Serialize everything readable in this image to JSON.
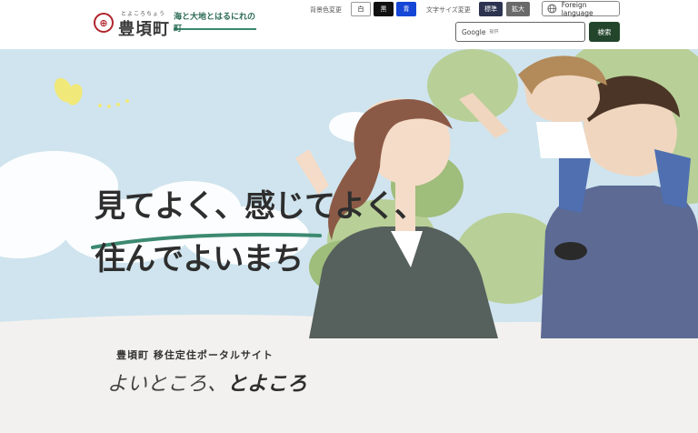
{
  "header": {
    "logo": {
      "seal_icon": "town-seal-icon",
      "ruby": "とよころちょう",
      "town_name": "豊頃町",
      "tagline": "海と大地とはるにれの町"
    },
    "background_color": {
      "label": "背景色変更",
      "options": [
        {
          "label": "白",
          "color": "#ffffff"
        },
        {
          "label": "黒",
          "color": "#111111"
        },
        {
          "label": "青",
          "color": "#1546d6"
        }
      ]
    },
    "font_size": {
      "label": "文字サイズ変更",
      "options": [
        {
          "label": "標準"
        },
        {
          "label": "拡大"
        }
      ]
    },
    "language_button": {
      "icon": "globe-icon",
      "label": "Foreign language"
    },
    "search": {
      "brand": "Google",
      "placeholder": "提供",
      "button_label": "検索"
    }
  },
  "hero": {
    "catch_line1": "見てよく、感じてよく、",
    "catch_line2": "住んでよいまち",
    "colors": {
      "sky": "#cfe4ee",
      "accent": "#3c8a70"
    }
  },
  "intro": {
    "portal_title": "豊頃町 移住定住ポータルサイト",
    "slogan_light": "よいところ、",
    "slogan_strong": "とよころ"
  }
}
